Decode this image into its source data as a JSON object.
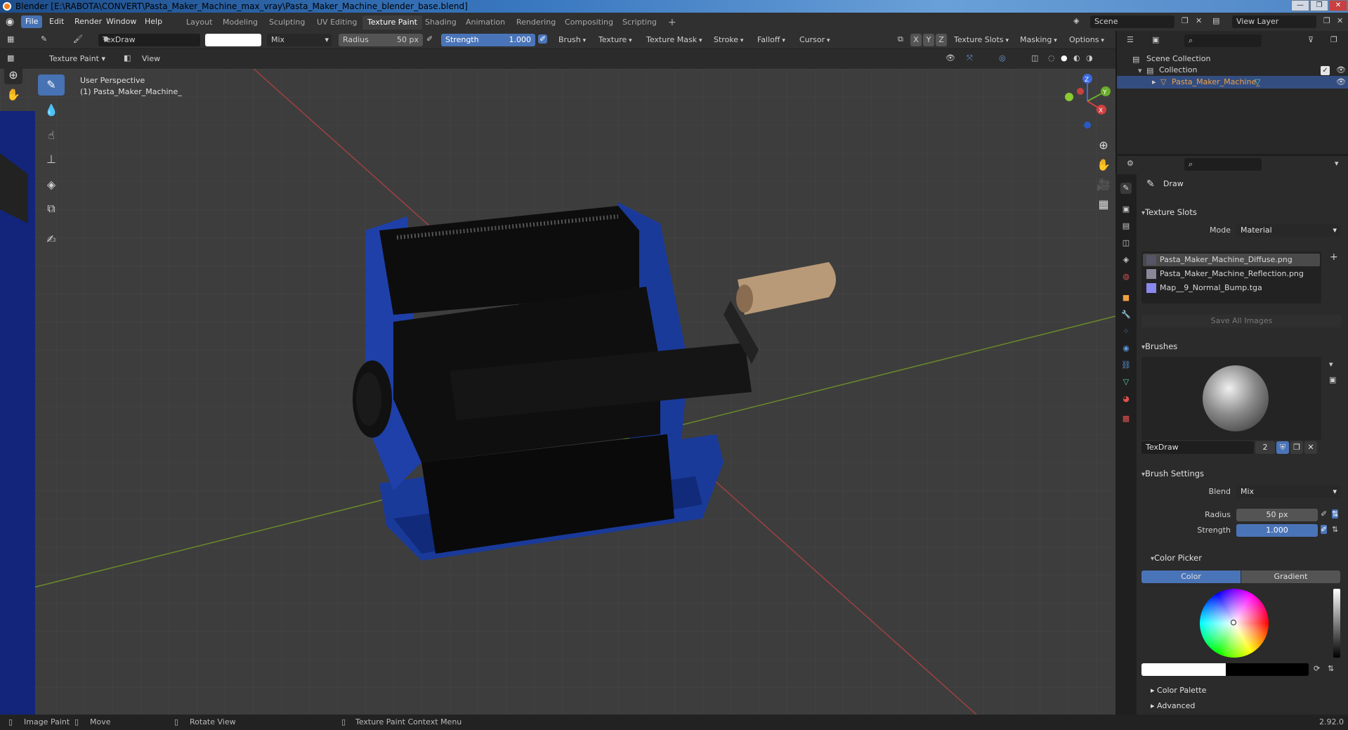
{
  "window": {
    "title": "Blender [E:\\RABOTA\\CONVERT\\Pasta_Maker_Machine_max_vray\\Pasta_Maker_Machine_blender_base.blend]",
    "min": "—",
    "max": "❐",
    "close": "✕"
  },
  "menu": [
    "File",
    "Edit",
    "Render",
    "Window",
    "Help"
  ],
  "workspaces": [
    "Layout",
    "Modeling",
    "Sculpting",
    "UV Editing",
    "Texture Paint",
    "Shading",
    "Animation",
    "Rendering",
    "Compositing",
    "Scripting"
  ],
  "active_workspace": "Texture Paint",
  "add_ws": "+",
  "scene": {
    "label": "Scene",
    "view_layer": "View Layer"
  },
  "tool_header": {
    "brush_name": "TexDraw",
    "blend": "Mix",
    "radius_label": "Radius",
    "radius_value": "50 px",
    "strength_label": "Strength",
    "strength_value": "1.000",
    "menus": [
      "Brush",
      "Texture",
      "Texture Mask",
      "Stroke",
      "Falloff",
      "Cursor"
    ],
    "xyz": [
      "X",
      "Y",
      "Z"
    ],
    "right_menus": [
      "Texture Slots",
      "Masking",
      "Options"
    ]
  },
  "viewport_header": {
    "mode": "Texture Paint",
    "view": "View"
  },
  "viewport": {
    "perspective": "User Perspective",
    "object": "(1) Pasta_Maker_Machine_",
    "gizmo": {
      "x": "X",
      "y": "Y",
      "z": "Z"
    }
  },
  "outliner": {
    "scene_collection": "Scene Collection",
    "collection": "Collection",
    "object": "Pasta_Maker_Machine_"
  },
  "props": {
    "tool_name": "Draw",
    "texture_slots": {
      "header": "Texture Slots",
      "mode_label": "Mode",
      "mode_value": "Material",
      "images": [
        "Pasta_Maker_Machine_Diffuse.png",
        "Pasta_Maker_Machine_Reflection.png",
        "Map__9_Normal_Bump.tga"
      ],
      "save_all": "Save All Images"
    },
    "brushes": {
      "header": "Brushes",
      "name": "TexDraw",
      "users": "2"
    },
    "brush_settings": {
      "header": "Brush Settings",
      "blend_label": "Blend",
      "blend_value": "Mix",
      "radius_label": "Radius",
      "radius_value": "50 px",
      "strength_label": "Strength",
      "strength_value": "1.000"
    },
    "color_picker": {
      "header": "Color Picker",
      "tabs": [
        "Color",
        "Gradient"
      ]
    },
    "color_palette": "Color Palette",
    "advanced": "Advanced"
  },
  "status": {
    "image_paint": "Image Paint",
    "move": "Move",
    "rotate": "Rotate View",
    "context": "Texture Paint Context Menu",
    "version": "2.92.0"
  },
  "colors": {
    "accent": "#4772b3",
    "body_blue": "#1a3a9a",
    "handle": "#b89a78"
  }
}
